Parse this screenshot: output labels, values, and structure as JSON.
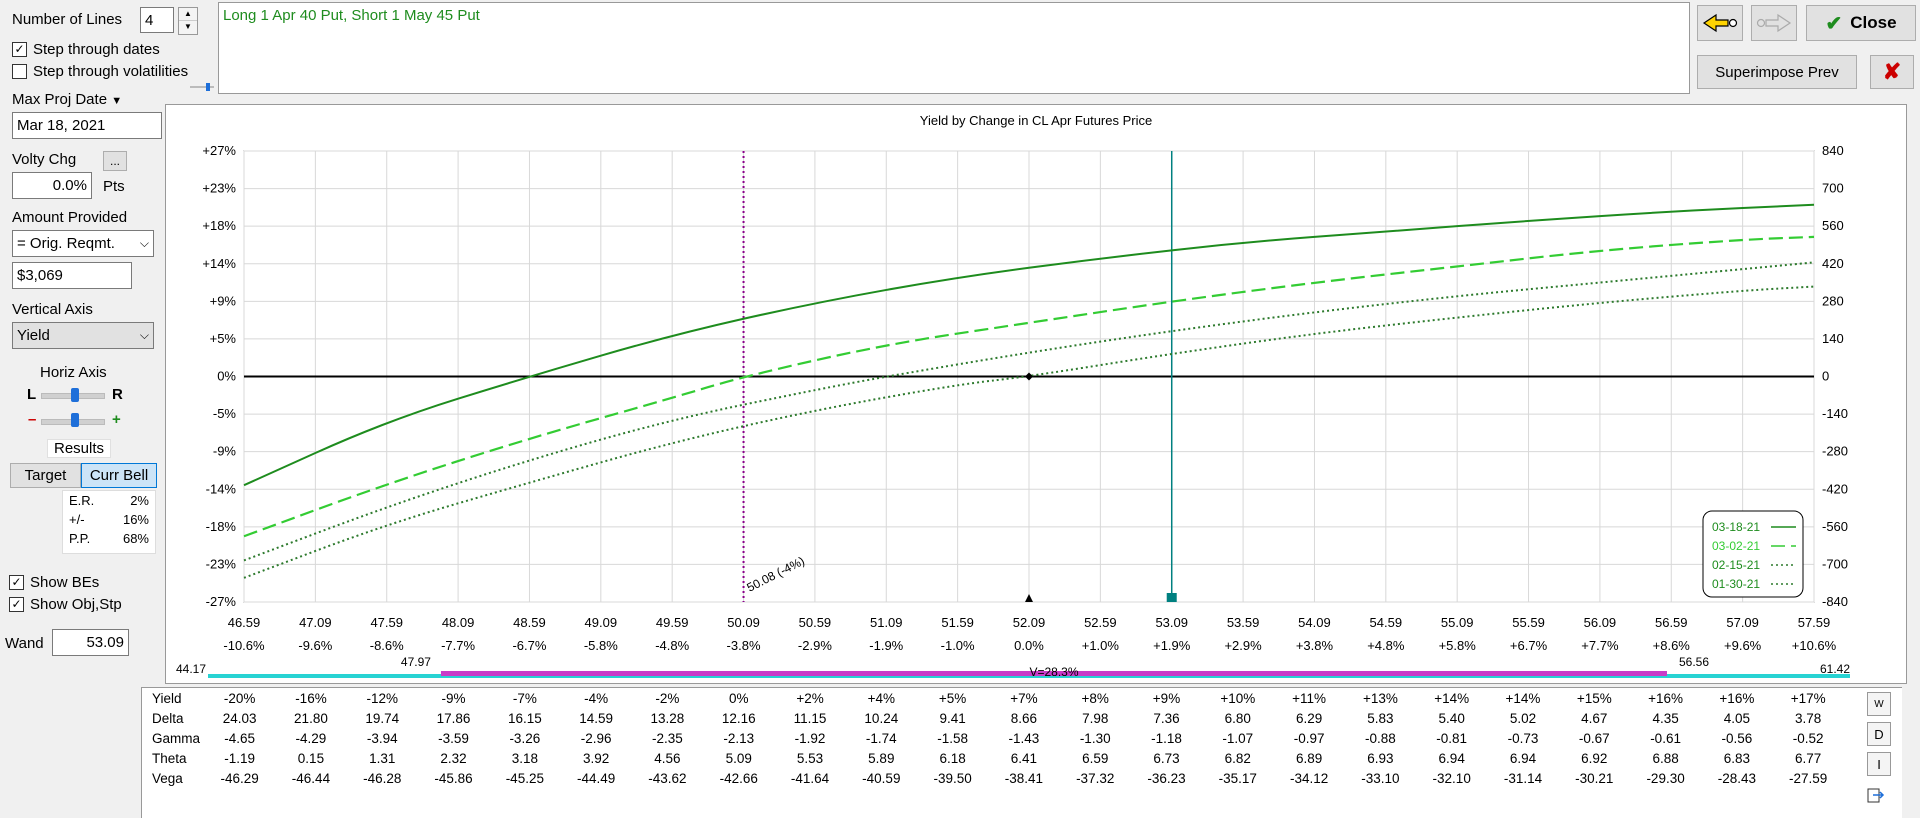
{
  "controls": {
    "num_lines_label": "Number of Lines",
    "num_lines_value": "4",
    "step_dates_label": "Step through dates",
    "step_dates_checked": "✓",
    "step_vol_label": "Step through volatilities",
    "max_proj_label": "Max Proj Date",
    "max_proj_value": "Mar 18, 2021",
    "volty_label": "Volty Chg",
    "volty_btn": "...",
    "volty_value": "0.0%",
    "volty_unit": "Pts",
    "amount_label": "Amount Provided",
    "amount_option": "= Orig. Reqmt.",
    "amount_value": "$3,069",
    "vert_axis_label": "Vertical Axis",
    "vert_axis_value": "Yield",
    "horiz_axis_label": "Horiz Axis",
    "horiz_l": "L",
    "horiz_r": "R",
    "minus": "–",
    "plus": "+",
    "results_label": "Results",
    "target_btn": "Target",
    "curr_bell_btn": "Curr Bell",
    "results": [
      {
        "k": "E.R.",
        "v": "2%"
      },
      {
        "k": "+/-",
        "v": "16%"
      },
      {
        "k": "P.P.",
        "v": "68%"
      }
    ],
    "show_bes_label": "Show BEs",
    "show_obj_label": "Show Obj,Stp",
    "wand_label": "Wand",
    "wand_value": "53.09"
  },
  "description": "Long 1 Apr 40 Put, Short 1 May 45 Put",
  "buttons": {
    "close": "Close",
    "superimpose": "Superimpose Prev"
  },
  "chart_data": {
    "type": "line",
    "title": "Yield by Change in CL Apr Futures Price",
    "x_prices": [
      "46.59",
      "47.09",
      "47.59",
      "48.09",
      "48.59",
      "49.09",
      "49.59",
      "50.09",
      "50.59",
      "51.09",
      "51.59",
      "52.09",
      "52.59",
      "53.09",
      "53.59",
      "54.09",
      "54.59",
      "55.09",
      "55.59",
      "56.09",
      "56.59",
      "57.09",
      "57.59"
    ],
    "x_pct": [
      "-10.6%",
      "-9.6%",
      "-8.6%",
      "-7.7%",
      "-6.7%",
      "-5.8%",
      "-4.8%",
      "-3.8%",
      "-2.9%",
      "-1.9%",
      "-1.0%",
      "0.0%",
      "+1.0%",
      "+1.9%",
      "+2.9%",
      "+3.8%",
      "+4.8%",
      "+5.8%",
      "+6.7%",
      "+7.7%",
      "+8.6%",
      "+9.6%",
      "+10.6%"
    ],
    "x_range": [
      46.59,
      57.59
    ],
    "y_left_ticks": [
      "+27%",
      "+23%",
      "+18%",
      "+14%",
      "+9%",
      "+5%",
      "0%",
      "-5%",
      "-9%",
      "-14%",
      "-18%",
      "-23%",
      "-27%"
    ],
    "y_right_ticks": [
      "840",
      "700",
      "560",
      "420",
      "280",
      "140",
      "0",
      "-140",
      "-280",
      "-420",
      "-560",
      "-700",
      "-840"
    ],
    "y_range": [
      -840,
      840
    ],
    "series": [
      {
        "name": "03-18-21",
        "style": "solid",
        "x": [
          46.59,
          47.59,
          48.59,
          49.59,
          50.59,
          51.59,
          52.59,
          53.59,
          54.59,
          55.59,
          56.59,
          57.59
        ],
        "y": [
          -405,
          -165,
          0,
          155,
          275,
          370,
          440,
          500,
          540,
          580,
          615,
          640
        ]
      },
      {
        "name": "03-02-21",
        "style": "dashed",
        "x": [
          46.59,
          47.59,
          48.59,
          49.59,
          50.09,
          51.09,
          52.09,
          53.09,
          54.09,
          55.09,
          56.09,
          57.09,
          57.59
        ],
        "y": [
          -595,
          -400,
          -230,
          -80,
          0,
          120,
          200,
          280,
          350,
          410,
          470,
          510,
          520
        ]
      },
      {
        "name": "02-15-21",
        "style": "dotted",
        "x": [
          46.59,
          47.59,
          48.59,
          49.59,
          50.59,
          51.09,
          52.09,
          53.09,
          54.09,
          55.09,
          56.09,
          57.09,
          57.59
        ],
        "y": [
          -685,
          -485,
          -310,
          -160,
          -50,
          0,
          90,
          170,
          240,
          300,
          350,
          400,
          425
        ]
      },
      {
        "name": "01-30-21",
        "style": "dotted",
        "x": [
          46.59,
          47.59,
          48.59,
          49.59,
          50.59,
          51.59,
          52.09,
          53.09,
          54.09,
          55.09,
          56.09,
          57.09,
          57.59
        ],
        "y": [
          -750,
          -550,
          -395,
          -245,
          -125,
          -30,
          0,
          85,
          160,
          220,
          275,
          320,
          335
        ]
      }
    ],
    "purple_marker_x": 50.09,
    "purple_marker_label": "50.08 (-4%)",
    "wand_x": 53.09,
    "current_x": 52.09,
    "bell": {
      "low": "44.17",
      "left": "47.97",
      "center": "V=28.3%",
      "right": "56.56",
      "high": "61.42"
    },
    "legend_position": "bottom-right"
  },
  "table": {
    "yield": [
      "-20%",
      "-16%",
      "-12%",
      "-9%",
      "-7%",
      "-4%",
      "-2%",
      "0%",
      "+2%",
      "+4%",
      "+5%",
      "+7%",
      "+8%",
      "+9%",
      "+10%",
      "+11%",
      "+13%",
      "+14%",
      "+14%",
      "+15%",
      "+16%",
      "+16%",
      "+17%"
    ],
    "delta": [
      "24.03",
      "21.80",
      "19.74",
      "17.86",
      "16.15",
      "14.59",
      "13.28",
      "12.16",
      "11.15",
      "10.24",
      "9.41",
      "8.66",
      "7.98",
      "7.36",
      "6.80",
      "6.29",
      "5.83",
      "5.40",
      "5.02",
      "4.67",
      "4.35",
      "4.05",
      "3.78"
    ],
    "gamma": [
      "-4.65",
      "-4.29",
      "-3.94",
      "-3.59",
      "-3.26",
      "-2.96",
      "-2.35",
      "-2.13",
      "-1.92",
      "-1.74",
      "-1.58",
      "-1.43",
      "-1.30",
      "-1.18",
      "-1.07",
      "-0.97",
      "-0.88",
      "-0.81",
      "-0.73",
      "-0.67",
      "-0.61",
      "-0.56",
      "-0.52"
    ],
    "theta": [
      "-1.19",
      "0.15",
      "1.31",
      "2.32",
      "3.18",
      "3.92",
      "4.56",
      "5.09",
      "5.53",
      "5.89",
      "6.18",
      "6.41",
      "6.59",
      "6.73",
      "6.82",
      "6.89",
      "6.93",
      "6.94",
      "6.94",
      "6.92",
      "6.88",
      "6.83",
      "6.77"
    ],
    "vega": [
      "-46.29",
      "-46.44",
      "-46.28",
      "-45.86",
      "-45.25",
      "-44.49",
      "-43.62",
      "-42.66",
      "-41.64",
      "-40.59",
      "-39.50",
      "-38.41",
      "-37.32",
      "-36.23",
      "-35.17",
      "-34.12",
      "-33.10",
      "-32.10",
      "-31.14",
      "-30.21",
      "-29.30",
      "-28.43",
      "-27.59"
    ],
    "labels": {
      "yield": "Yield",
      "delta": "Delta",
      "gamma": "Gamma",
      "theta": "Theta",
      "vega": "Vega"
    },
    "side_w": "W",
    "side_d": "D",
    "side_i": "I"
  },
  "colors": {
    "solid": "#1e8c1e",
    "dashed": "#33cc33",
    "dotted": "#2d7a2d",
    "purple": "#8b008b",
    "teal": "#008080",
    "bell_teal": "#27d3d3",
    "bell_magenta": "#c83cc8"
  }
}
